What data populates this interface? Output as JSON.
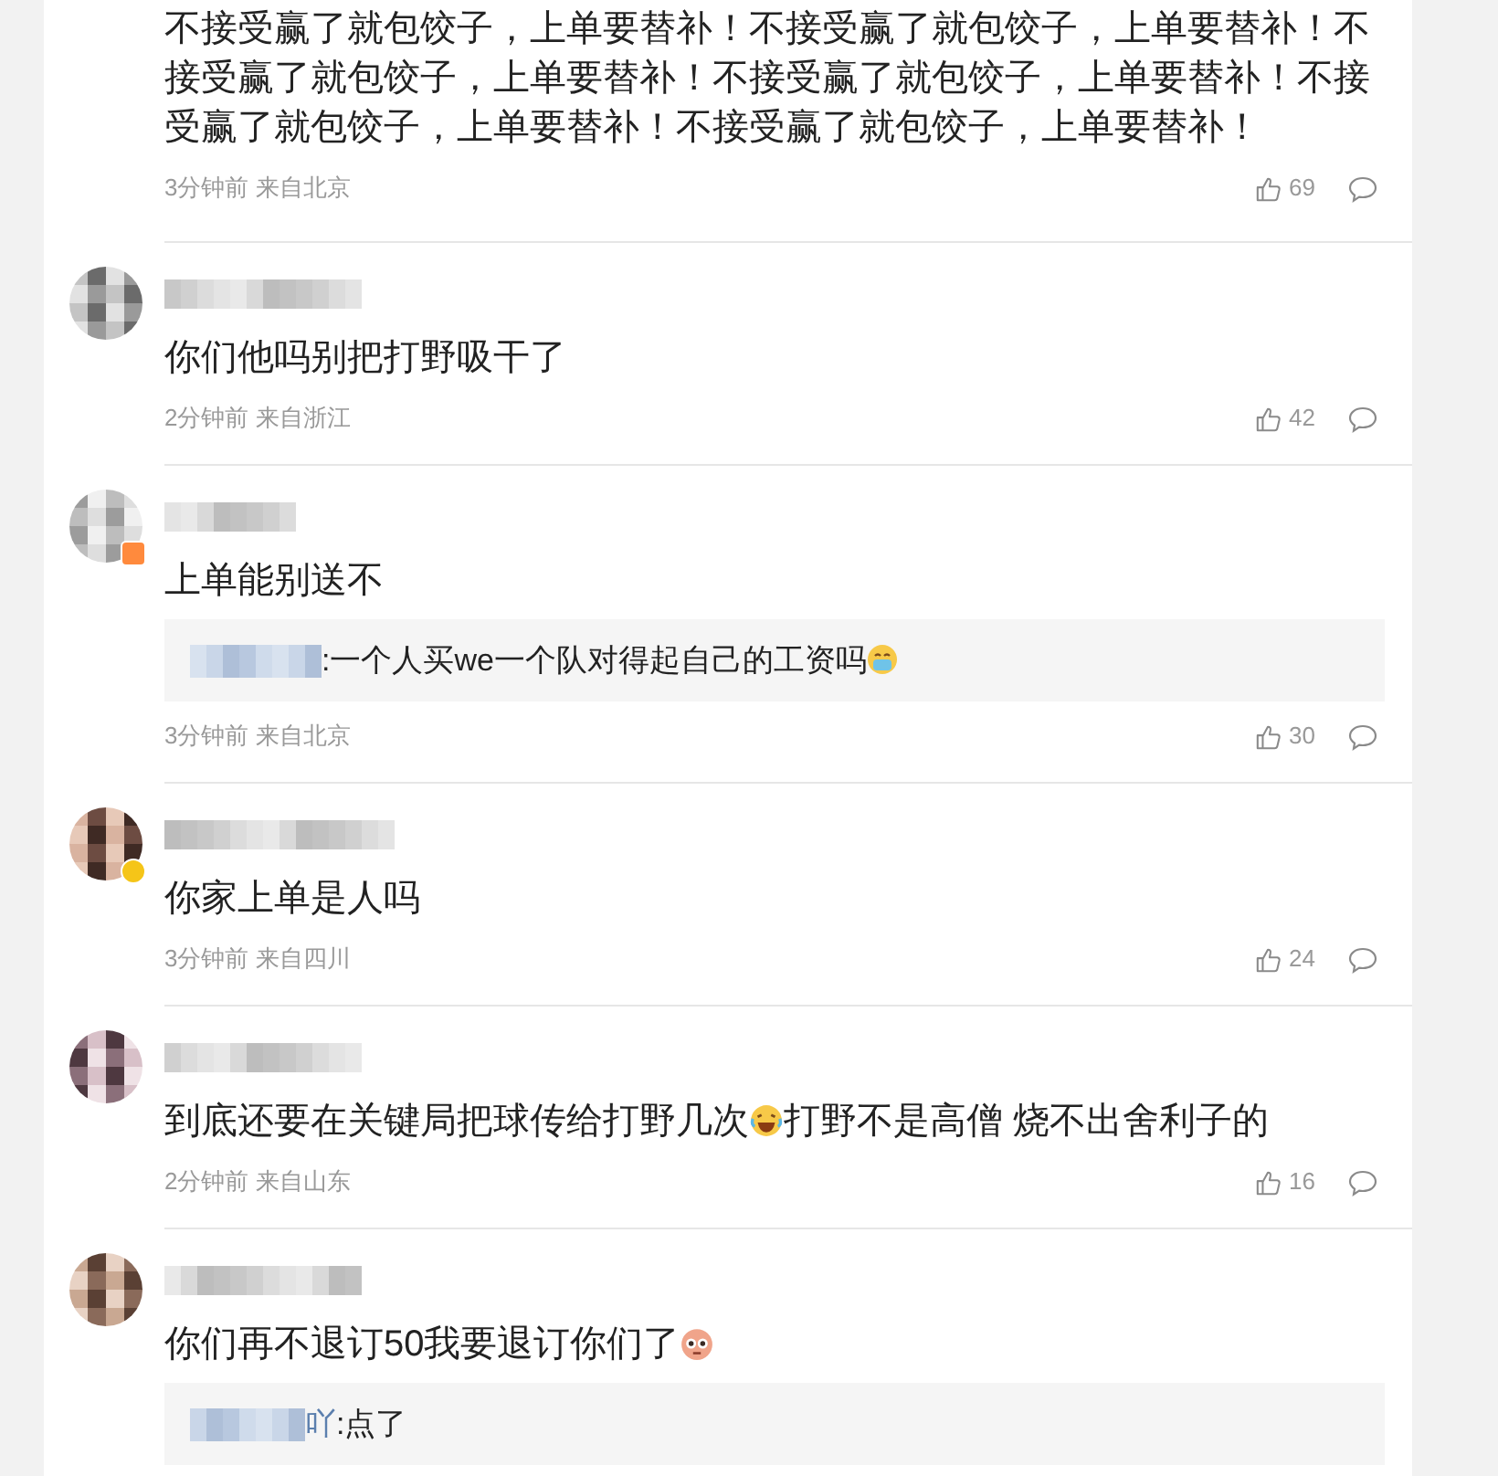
{
  "comments": [
    {
      "text": "不接受赢了就包饺子，上单要替补！不接受赢了就包饺子，上单要替补！不接受赢了就包饺子，上单要替补！不接受赢了就包饺子，上单要替补！不接受赢了就包饺子，上单要替补！不接受赢了就包饺子，上单要替补！",
      "meta": "3分钟前 来自北京",
      "likes": "69"
    },
    {
      "avatar": true,
      "text": "你们他吗别把打野吸干了",
      "meta": "2分钟前 来自浙江",
      "likes": "42"
    },
    {
      "avatar": true,
      "badge": {
        "kind": "vip"
      },
      "text": "上单能别送不",
      "reply": {
        "text": ":一个人买we一个队对得起自己的工资吗",
        "emoji": {
          "kind": "cry"
        }
      },
      "meta": "3分钟前 来自北京",
      "likes": "30"
    },
    {
      "avatar": true,
      "badge": {
        "kind": "verified"
      },
      "text": "你家上单是人吗",
      "meta": "3分钟前 来自四川",
      "likes": "24"
    },
    {
      "avatar": true,
      "text": "到底还要在关键局把球传给打野几次",
      "emoji": {
        "kind": "laugh"
      },
      "text_after": "打野不是高僧 烧不出舍利子的",
      "meta": "2分钟前 来自山东",
      "likes": "16"
    },
    {
      "avatar": true,
      "text": "你们再不退订50我要退订你们了",
      "emoji": {
        "kind": "monkey"
      },
      "reply": {
        "author_visible": "吖",
        "text": ":点了"
      }
    }
  ]
}
